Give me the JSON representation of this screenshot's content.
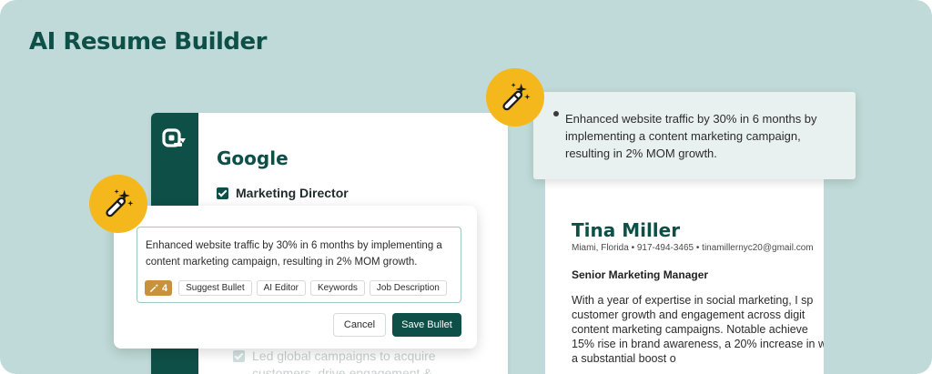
{
  "hero": {
    "title": "AI Resume Builder"
  },
  "colors": {
    "brand": "#0e4f47",
    "background": "#bfdad8",
    "accent": "#f4b81c",
    "credit": "#c7923a"
  },
  "editor": {
    "logo_icon": "app-logo-icon",
    "company": "Google",
    "role": "Marketing Director",
    "faded_bullet": "Led global campaigns to acquire customers, drive engagement &"
  },
  "bullet_editor": {
    "text": "Enhanced website traffic by 30% in 6 months by implementing a content marketing campaign, resulting in 2% MOM growth.",
    "credits": "4",
    "tools": [
      "Suggest Bullet",
      "AI Editor",
      "Keywords",
      "Job Description"
    ],
    "cancel_label": "Cancel",
    "save_label": "Save Bullet"
  },
  "suggestion": {
    "text": "Enhanced website traffic by 30% in 6 months by implementing a content marketing campaign, resulting in 2% MOM growth."
  },
  "resume": {
    "name": "Tina Miller",
    "contact": "Miami, Florida • 917-494-3465 • tinamillernyc20@gmail.com",
    "job_title": "Senior Marketing Manager",
    "summary_lines": [
      "With a year of expertise in social marketing, I sp",
      "customer growth and engagement across digit",
      "content marketing campaigns. Notable achieve",
      "15% rise in brand awareness, a 20% increase in w",
      "a substantial boost o"
    ]
  }
}
